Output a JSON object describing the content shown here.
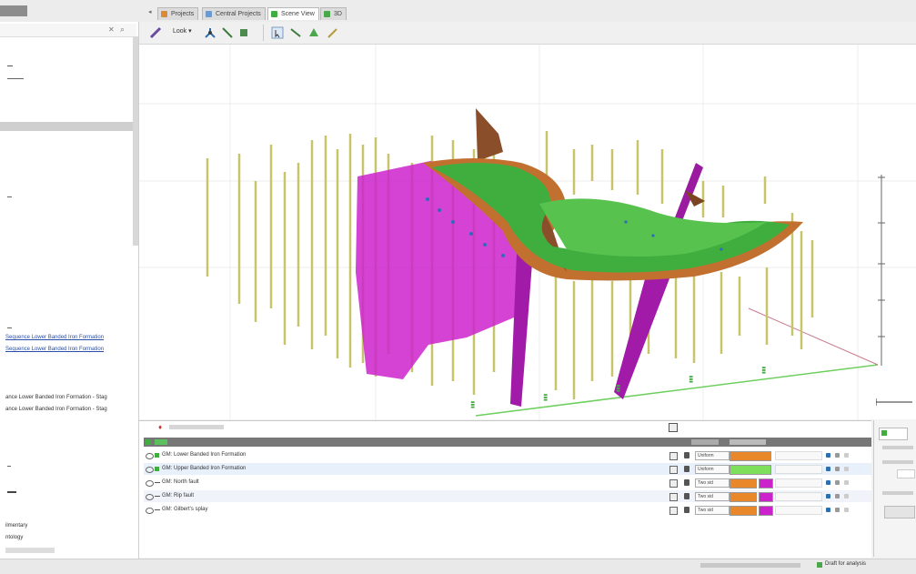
{
  "colors": {
    "accent_green": "#3fae3f",
    "magenta": "#cc22cc",
    "orange": "#e8882a",
    "lime": "#7ee05a",
    "olive": "#c8c46a"
  },
  "tabs": [
    {
      "label": "Projects",
      "icon": "projects-icon"
    },
    {
      "label": "Central Projects",
      "icon": "central-icon"
    },
    {
      "label": "Scene View",
      "icon": "scene-icon"
    },
    {
      "label": "3D",
      "icon": "3d-icon"
    }
  ],
  "toolbar": {
    "look_label": "Look ▾"
  },
  "left_panel": {
    "lines": [
      {
        "text": "Sequence Lower Banded Iron Formation",
        "link": true
      },
      {
        "text": "Sequence Lower Banded Iron Formation",
        "link": true
      },
      {
        "text": "ance Lower Banded Iron Formation - Stag",
        "link": false
      },
      {
        "text": "ance Lower Banded Iron Formation - Stag",
        "link": false
      },
      {
        "text": "ilmentary",
        "link": false
      },
      {
        "text": "ntology",
        "link": false
      }
    ]
  },
  "bottom_panel": {
    "rows": [
      {
        "name": "GM: Lower Banded Iron Formation",
        "mode": "Uniform",
        "swatch1": "#e8882a",
        "swatch2": "",
        "selected": false
      },
      {
        "name": "GM: Upper Banded Iron Formation",
        "mode": "Uniform",
        "swatch1": "#7ee05a",
        "swatch2": "",
        "selected": true
      },
      {
        "name": "GM: North fault",
        "mode": "Two sid",
        "swatch1": "#e8882a",
        "swatch2": "#cc22cc",
        "selected": false
      },
      {
        "name": "GM: Rip fault",
        "mode": "Two sid",
        "swatch1": "#e8882a",
        "swatch2": "#cc22cc",
        "selected": false
      },
      {
        "name": "GM: Gilbert's splay",
        "mode": "Two sid",
        "swatch1": "#e8882a",
        "swatch2": "#cc22cc",
        "selected": false
      }
    ]
  },
  "status": {
    "check_label": "Draft for analysis"
  }
}
